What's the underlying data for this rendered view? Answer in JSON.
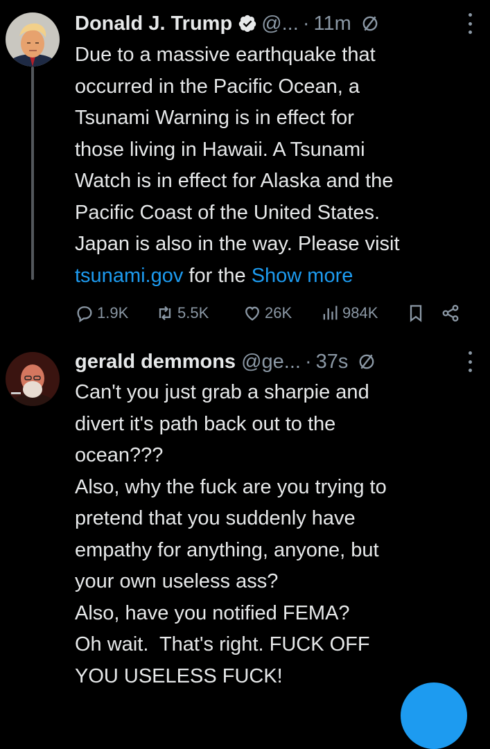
{
  "post1": {
    "author_name": "Donald J. Trump",
    "handle": "@...",
    "separator": "·",
    "time": "11m",
    "body_lines": [
      "Due to a massive earthquake that",
      "occurred in the Pacific Ocean, a",
      "Tsunami Warning is in effect for",
      "those living in Hawaii. A Tsunami",
      "Watch is in effect for Alaska and the",
      "Pacific Coast of the United States.",
      "Japan is also in the way. Please visit"
    ],
    "link_text": "tsunami.gov",
    "tail_text": " for the ",
    "show_more": "Show more",
    "stats": {
      "replies": "1.9K",
      "reposts": "5.5K",
      "likes": "26K",
      "views": "984K"
    }
  },
  "post2": {
    "author_name": "gerald demmons",
    "handle": "@ge...",
    "separator": "·",
    "time": "37s",
    "body_lines": [
      "Can't you just grab a sharpie and",
      "divert it's path back out to the",
      "ocean???",
      "Also, why the fuck are you trying to",
      "pretend that you suddenly have",
      "empathy for anything, anyone, but",
      "your own useless ass?",
      "Also, have you notified FEMA?",
      "Oh wait.  That's right. FUCK OFF",
      "YOU USELESS FUCK!"
    ]
  },
  "colors": {
    "background": "#000000",
    "text": "#e7e9ea",
    "muted": "#8b98a5",
    "accent": "#1d9bf0"
  },
  "icons": [
    "verified-badge-icon",
    "mute-icon",
    "more-options-icon",
    "reply-icon",
    "repost-icon",
    "like-icon",
    "views-icon",
    "bookmark-icon",
    "share-icon"
  ]
}
